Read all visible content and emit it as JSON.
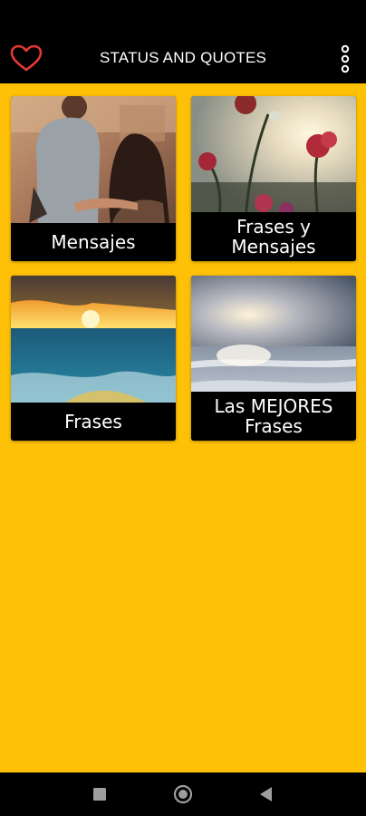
{
  "app": {
    "title": "STATUS AND QUOTES",
    "accent_color": "#ffc107",
    "bar_color": "#000000",
    "heart_color": "#e53935"
  },
  "toolbar": {
    "favorite_icon": "heart-outline-icon",
    "menu_icon": "more-vert-icon"
  },
  "cards": [
    {
      "label": "Mensajes",
      "image": "couple-photo"
    },
    {
      "label": "Frases y Mensajes",
      "image": "flowers-sunset-photo"
    },
    {
      "label": "Frases",
      "image": "ocean-sunset-photo"
    },
    {
      "label": "Las MEJORES Frases",
      "image": "beach-sunrise-photo"
    }
  ],
  "navigation": {
    "recents_icon": "square-icon",
    "home_icon": "circle-icon",
    "back_icon": "triangle-back-icon"
  }
}
